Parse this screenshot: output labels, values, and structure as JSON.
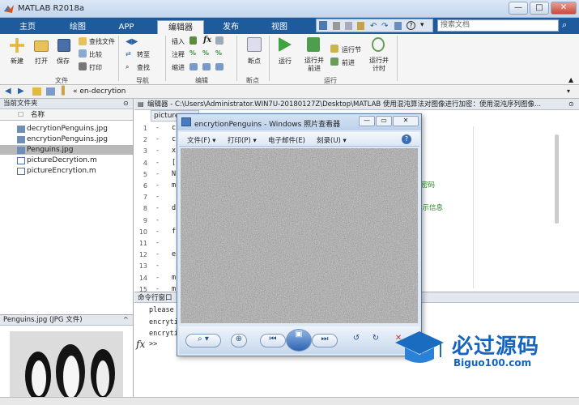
{
  "app": {
    "title": "MATLAB R2018a"
  },
  "window_controls": {
    "minimize": "—",
    "maximize": "□",
    "close": "✕"
  },
  "tabs": [
    {
      "label": "主页"
    },
    {
      "label": "绘图"
    },
    {
      "label": "APP"
    },
    {
      "label": "编辑器",
      "active": true
    },
    {
      "label": "发布"
    },
    {
      "label": "视图"
    }
  ],
  "search": {
    "placeholder": "搜索文档"
  },
  "ribbon": {
    "new": "新建",
    "open": "打开",
    "save": "保存",
    "find_files": "查找文件",
    "compare": "比较",
    "print": "打印",
    "goto": "转至",
    "find": "查找",
    "insert": "插入",
    "comment": "注释",
    "indent": "缩进",
    "breakpoints": "断点",
    "run": "运行",
    "run_advance": "运行并前进",
    "run_section": "运行节",
    "advance": "前进",
    "run_time": "运行并计时",
    "groups": {
      "file": "文件",
      "nav": "导航",
      "edit": "编辑",
      "bp": "断点",
      "run": "运行"
    }
  },
  "address": {
    "path": "« en-decrytion"
  },
  "file_panel": {
    "title": "当前文件夹",
    "col_name": "名称",
    "files": [
      {
        "name": "decrytionPenguins.jpg"
      },
      {
        "name": "encrytionPenguins.jpg"
      },
      {
        "name": "Penguins.jpg",
        "selected": true
      },
      {
        "name": "pictureDecrytion.m"
      },
      {
        "name": "pictureEncrytion.m"
      }
    ]
  },
  "detail": {
    "title": "Penguins.jpg  (JPG 文件)"
  },
  "editor": {
    "title": "编辑器 - C:\\Users\\Administrator.WIN7U-20180127Z\\Desktop\\MATLAB 使用混沌算法对图像进行加密：使用混沌序列图像...",
    "tab": "picture",
    "lines": [
      "1",
      "2",
      "3",
      "4",
      "5",
      "6",
      "7",
      "8",
      "9",
      "10",
      "11",
      "12",
      "13",
      "14",
      "15"
    ],
    "code_chars": [
      "c",
      "c",
      "x",
      "[",
      "N",
      "m",
      "",
      "d",
      "",
      "f",
      "",
      "e",
      "",
      "m",
      "m"
    ],
    "comment1": "密码",
    "comment2": "提示信息"
  },
  "command": {
    "title": "命令行窗口",
    "lines": [
      "please",
      "encryti",
      "encryti"
    ],
    "prompt": ">>",
    "fx": "fx"
  },
  "viewer": {
    "title": "encrytionPenguins - Windows 照片查看器",
    "menus": [
      "文件(F) ▾",
      "打印(P) ▾",
      "电子邮件(E)",
      "刻录(U) ▾"
    ],
    "help": "?"
  },
  "watermark": {
    "text": "必过源码",
    "url": "Biguo100.com"
  }
}
